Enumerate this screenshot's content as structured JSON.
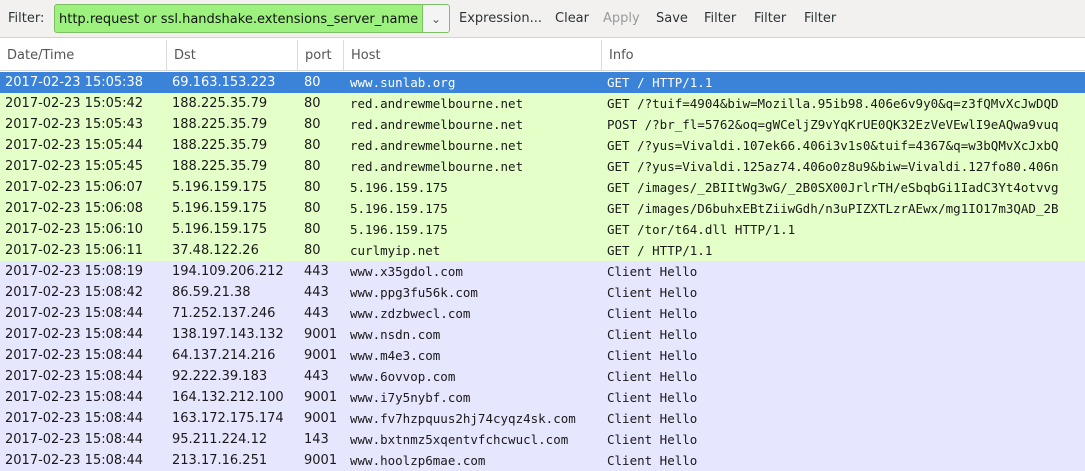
{
  "toolbar": {
    "filter_label": "Filter:",
    "filter_value": "http.request or ssl.handshake.extensions_server_name",
    "expression_label": "Expression...",
    "clear_label": "Clear",
    "apply_label": "Apply",
    "save_label": "Save",
    "filter_buttons": [
      "Filter",
      "Filter",
      "Filter"
    ],
    "filter_color": "#9df27f"
  },
  "columns": [
    "Date/Time",
    "Dst",
    "port",
    "Host",
    "Info"
  ],
  "colors": {
    "selected": "#3b83d8",
    "http": "#e4ffc7",
    "tls": "#e7e6ff"
  },
  "packets": [
    {
      "time": "2017-02-23 15:05:38",
      "dst": "69.163.153.223",
      "port": "80",
      "host": "www.sunlab.org",
      "info": "GET / HTTP/1.1",
      "type": "selected"
    },
    {
      "time": "2017-02-23 15:05:42",
      "dst": "188.225.35.79",
      "port": "80",
      "host": "red.andrewmelbourne.net",
      "info": "GET /?tuif=4904&biw=Mozilla.95ib98.406e6v9y0&q=z3fQMvXcJwDQD",
      "type": "http"
    },
    {
      "time": "2017-02-23 15:05:43",
      "dst": "188.225.35.79",
      "port": "80",
      "host": "red.andrewmelbourne.net",
      "info": "POST /?br_fl=5762&oq=gWCeljZ9vYqKrUE0QK32EzVeVEwlI9eAQwa9vuq",
      "type": "http"
    },
    {
      "time": "2017-02-23 15:05:44",
      "dst": "188.225.35.79",
      "port": "80",
      "host": "red.andrewmelbourne.net",
      "info": "GET /?yus=Vivaldi.107ek66.406i3v1s0&tuif=4367&q=w3bQMvXcJxbQ",
      "type": "http"
    },
    {
      "time": "2017-02-23 15:05:45",
      "dst": "188.225.35.79",
      "port": "80",
      "host": "red.andrewmelbourne.net",
      "info": "GET /?yus=Vivaldi.125az74.406o0z8u9&biw=Vivaldi.127fo80.406n",
      "type": "http"
    },
    {
      "time": "2017-02-23 15:06:07",
      "dst": "5.196.159.175",
      "port": "80",
      "host": "5.196.159.175",
      "info": "GET /images/_2BIItWg3wG/_2B0SX00JrlrTH/eSbqbGi1IadC3Yt4otvvg",
      "type": "http"
    },
    {
      "time": "2017-02-23 15:06:08",
      "dst": "5.196.159.175",
      "port": "80",
      "host": "5.196.159.175",
      "info": "GET /images/D6buhxEBtZiiwGdh/n3uPIZXTLzrAEwx/mg1IO17m3QAD_2B",
      "type": "http"
    },
    {
      "time": "2017-02-23 15:06:10",
      "dst": "5.196.159.175",
      "port": "80",
      "host": "5.196.159.175",
      "info": "GET /tor/t64.dll HTTP/1.1",
      "type": "http"
    },
    {
      "time": "2017-02-23 15:06:11",
      "dst": "37.48.122.26",
      "port": "80",
      "host": "curlmyip.net",
      "info": "GET / HTTP/1.1",
      "type": "http"
    },
    {
      "time": "2017-02-23 15:08:19",
      "dst": "194.109.206.212",
      "port": "443",
      "host": "www.x35gdol.com",
      "info": "Client Hello",
      "type": "tls"
    },
    {
      "time": "2017-02-23 15:08:42",
      "dst": "86.59.21.38",
      "port": "443",
      "host": "www.ppg3fu56k.com",
      "info": "Client Hello",
      "type": "tls"
    },
    {
      "time": "2017-02-23 15:08:44",
      "dst": "71.252.137.246",
      "port": "443",
      "host": "www.zdzbwecl.com",
      "info": "Client Hello",
      "type": "tls"
    },
    {
      "time": "2017-02-23 15:08:44",
      "dst": "138.197.143.132",
      "port": "9001",
      "host": "www.nsdn.com",
      "info": "Client Hello",
      "type": "tls"
    },
    {
      "time": "2017-02-23 15:08:44",
      "dst": "64.137.214.216",
      "port": "9001",
      "host": "www.m4e3.com",
      "info": "Client Hello",
      "type": "tls"
    },
    {
      "time": "2017-02-23 15:08:44",
      "dst": "92.222.39.183",
      "port": "443",
      "host": "www.6ovvop.com",
      "info": "Client Hello",
      "type": "tls"
    },
    {
      "time": "2017-02-23 15:08:44",
      "dst": "164.132.212.100",
      "port": "9001",
      "host": "www.i7y5nybf.com",
      "info": "Client Hello",
      "type": "tls"
    },
    {
      "time": "2017-02-23 15:08:44",
      "dst": "163.172.175.174",
      "port": "9001",
      "host": "www.fv7hzpquus2hj74cyqz4sk.com",
      "info": "Client Hello",
      "type": "tls"
    },
    {
      "time": "2017-02-23 15:08:44",
      "dst": "95.211.224.12",
      "port": "143",
      "host": "www.bxtnmz5xqentvfchcwucl.com",
      "info": "Client Hello",
      "type": "tls"
    },
    {
      "time": "2017-02-23 15:08:44",
      "dst": "213.17.16.251",
      "port": "9001",
      "host": "www.hoolzp6mae.com",
      "info": "Client Hello",
      "type": "tls"
    }
  ]
}
